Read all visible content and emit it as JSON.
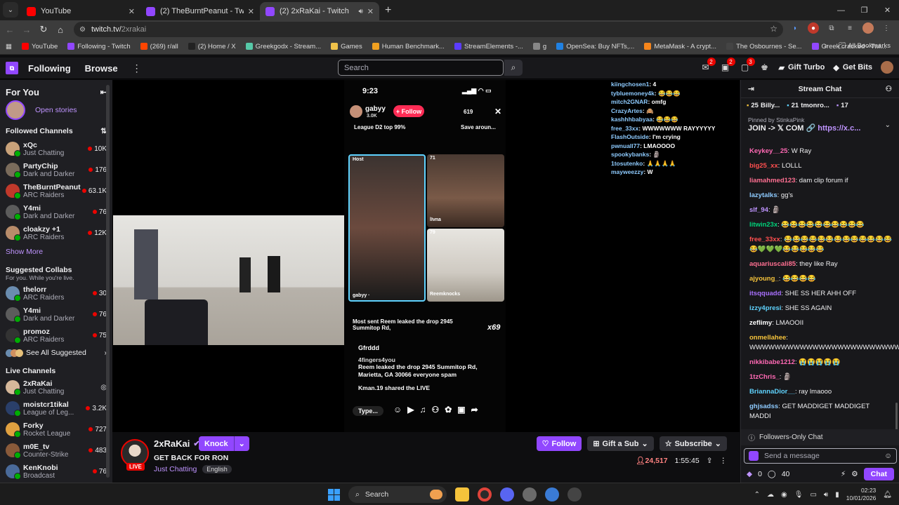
{
  "browser": {
    "tabs": [
      {
        "title": "YouTube",
        "color": "#ff0000",
        "active": false
      },
      {
        "title": "(2) TheBurntPeanut - Twitch",
        "color": "#9147ff",
        "active": false
      },
      {
        "title": "(2) 2xRaKai - Twitch",
        "color": "#9147ff",
        "active": true
      }
    ],
    "url_host": "twitch.tv/",
    "url_path": "2xrakai",
    "bookmarks": [
      {
        "label": "YouTube",
        "color": "#ff0000"
      },
      {
        "label": "Following - Twitch",
        "color": "#9147ff"
      },
      {
        "label": "(269) r/all",
        "color": "#ff4500"
      },
      {
        "label": "(2) Home / X",
        "color": "#222222"
      },
      {
        "label": "Greekgodx - Stream...",
        "color": "#56c9a8"
      },
      {
        "label": "Games",
        "color": "#f0c24a"
      },
      {
        "label": "Human Benchmark...",
        "color": "#f0a020"
      },
      {
        "label": "StreamElements -...",
        "color": "#5b3cff"
      },
      {
        "label": "g",
        "color": "#888888"
      },
      {
        "label": "OpenSea: Buy NFTs,...",
        "color": "#2081e2"
      },
      {
        "label": "MetaMask - A crypt...",
        "color": "#f6851b"
      },
      {
        "label": "The Osbournes - Se...",
        "color": "#444444"
      },
      {
        "label": "Greek cracked - Twi...",
        "color": "#9147ff"
      }
    ],
    "all_bookmarks": "All Bookmarks"
  },
  "twitch": {
    "nav": {
      "following": "Following",
      "browse": "Browse",
      "search_placeholder": "Search",
      "gift_turbo": "Gift Turbo",
      "get_bits": "Get Bits",
      "badges": [
        "2",
        "2",
        "3"
      ]
    },
    "sidebar": {
      "for_you": "For You",
      "open_stories": "Open stories",
      "followed_header": "Followed Channels",
      "followed": [
        {
          "name": "xQc",
          "game": "Just Chatting",
          "viewers": "10K",
          "color": "#c9a27a"
        },
        {
          "name": "PartyChip",
          "game": "Dark and Darker",
          "viewers": "176",
          "color": "#7a6b5b"
        },
        {
          "name": "TheBurntPeanut",
          "game": "ARC Raiders",
          "viewers": "63.1K",
          "color": "#c0392b"
        },
        {
          "name": "Y4mi",
          "game": "Dark and Darker",
          "viewers": "76",
          "color": "#5c5c5c"
        },
        {
          "name": "cloakzy +1",
          "game": "ARC Raiders",
          "viewers": "12K",
          "color": "#b88c6a"
        }
      ],
      "show_more": "Show More",
      "suggested_header": "Suggested Collabs",
      "suggested_sub": "For you. While you're live.",
      "suggested": [
        {
          "name": "thelorr",
          "game": "ARC Raiders",
          "viewers": "30",
          "color": "#6a8caf"
        },
        {
          "name": "Y4mi",
          "game": "Dark and Darker",
          "viewers": "76",
          "color": "#5c5c5c"
        },
        {
          "name": "promoz",
          "game": "ARC Raiders",
          "viewers": "75",
          "color": "#333333"
        }
      ],
      "see_all": "See All Suggested",
      "live_header": "Live Channels",
      "live": [
        {
          "name": "2xRaKai",
          "game": "Just Chatting",
          "viewers": "",
          "color": "#d6b89a"
        },
        {
          "name": "moistcr1tikal",
          "game": "League of Leg...",
          "viewers": "3.2K",
          "color": "#2a3f6a"
        },
        {
          "name": "Forky",
          "game": "Rocket League",
          "viewers": "727",
          "color": "#e0a040"
        },
        {
          "name": "m0E_tv",
          "game": "Counter-Strike",
          "viewers": "483",
          "color": "#8a5a3a"
        },
        {
          "name": "KenKnobi",
          "game": "Broadcast",
          "viewers": "76",
          "color": "#4a6a9a"
        }
      ]
    },
    "player": {
      "phone": {
        "time": "9:23",
        "host": "gabyy",
        "host_likes": "3.0K",
        "follow": "+ Follow",
        "viewers": "619",
        "league": "League D2 top 99%",
        "save": "Save aroun...",
        "tile1_label": "Host",
        "tile1_name": "gabyy ·",
        "tile2_count": "71",
        "tile2_name": "lIvna",
        "tile3_count": "79",
        "tile3_name": "Reemknocks",
        "most_sent": "Most sent Reem leaked the drop  2945 Summitop Rd,",
        "x69": "x69",
        "c1_user": "Gfrddd",
        "c2_user": "4fingers4you",
        "c2_text": "Reem leaked the drop  2945 Summitop Rd, Marietta, GA 30066  everyone spam",
        "c3": "Kman.19 shared the LIVE",
        "type": "Type..."
      },
      "overlay_chat": [
        {
          "u": "kiingchosen1",
          "t": "4"
        },
        {
          "u": "tybluemoney4k",
          "t": "😂😂😂"
        },
        {
          "u": "mitch2GNAR",
          "t": "omfg"
        },
        {
          "u": "CrazyArtes",
          "t": "🙈"
        },
        {
          "u": "kashhhbabyaa",
          "t": "😂😂😂"
        },
        {
          "u": "free_33xx",
          "t": "WWWWWWW RAYYYYYY"
        },
        {
          "u": "FlashOutside",
          "t": "I'm crying"
        },
        {
          "u": "pwnuall77",
          "t": "LMAOOOO"
        },
        {
          "u": "spookybanks",
          "t": "🗿"
        },
        {
          "u": "1tosutenko",
          "t": "🙏🙏🙏🙏"
        },
        {
          "u": "mayweezzy",
          "t": "W"
        }
      ]
    },
    "info": {
      "channel": "2xRaKai",
      "knock": "Knock",
      "title": "GET BACK FOR RON",
      "category": "Just Chatting",
      "tag": "English",
      "follow": "Follow",
      "gift_sub": "Gift a Sub",
      "subscribe": "Subscribe",
      "viewers": "24,517",
      "uptime": "1:55:45",
      "live": "LIVE"
    },
    "chat": {
      "header": "Stream Chat",
      "gift_leaders": [
        {
          "n": "25",
          "u": "Billy..."
        },
        {
          "n": "21",
          "u": "tmonro..."
        },
        {
          "n": "17",
          "u": ""
        }
      ],
      "pinned_by": "Pinned by  StinkaPink",
      "pinned_text": "JOIN -> 𝕏 COM 🔗 ",
      "pinned_link": "https://x.c...",
      "messages": [
        {
          "u": "Keykey__25",
          "c": "#ff69b4",
          "t": "W Ray"
        },
        {
          "u": "big25_xx",
          "c": "#ff4f4f",
          "t": "LOLLL"
        },
        {
          "u": "liamahmed123",
          "c": "#ff6f91",
          "t": "dam clip forum if"
        },
        {
          "u": "lazytalks",
          "c": "#8ecbff",
          "t": "gg's"
        },
        {
          "u": "slf_94",
          "c": "#bf94ff",
          "t": "🗿"
        },
        {
          "u": "litwin23x",
          "c": "#00d27a",
          "t": "😂😂😂😂😂😂😂😂😂😂"
        },
        {
          "u": "free_33xx",
          "c": "#ff4f4f",
          "t": "😂😂😂😂😂😂😂😂😂😂😂😂😂😂💚💚💚😂😂😂😂😂"
        },
        {
          "u": "aquariuscali85",
          "c": "#ff6f91",
          "t": "they like Ray"
        },
        {
          "u": "ajyoung_",
          "c": "#f5c33b",
          "t": "😂😂😂😂"
        },
        {
          "u": "itsqquadd",
          "c": "#a970ff",
          "t": "SHE SS HER AHH OFF"
        },
        {
          "u": "izzy4presi",
          "c": "#5fd3ff",
          "t": "SHE SS AGAIN"
        },
        {
          "u": "zeflimy",
          "c": "#ffffff",
          "t": "LMAOOII"
        },
        {
          "u": "onmellahee",
          "c": "#f5c33b",
          "t": "WWWWWWWWWWWWWWWWWWWWWWWW"
        },
        {
          "u": "nikkibabe1212",
          "c": "#ff69b4",
          "t": "😭😭😭😭😭"
        },
        {
          "u": "1tzChris_",
          "c": "#ff69b4",
          "t": "🗿"
        },
        {
          "u": "BriannaDior__",
          "c": "#5fd3ff",
          "t": "ray lmaooo"
        },
        {
          "u": "ghjsadss",
          "c": "#8ecbff",
          "t": "GET MADDIGET MADDIGET MADDI"
        }
      ],
      "followers_only": "Followers-Only Chat",
      "send_placeholder": "Send a message",
      "points": "0",
      "points2": "40",
      "chat_button": "Chat"
    }
  },
  "taskbar": {
    "search": "Search",
    "time": "02:23",
    "date": "10/01/2026"
  }
}
